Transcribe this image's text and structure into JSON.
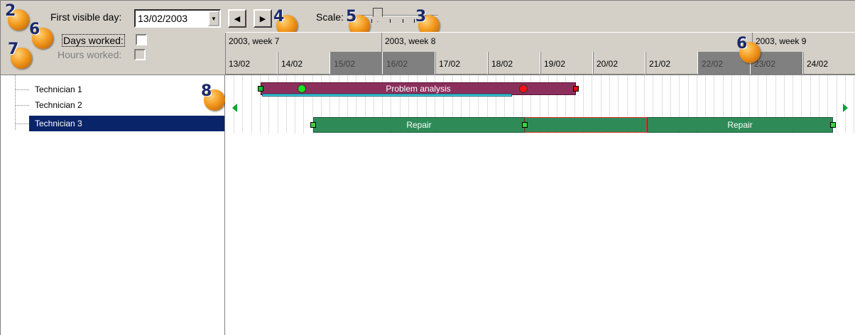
{
  "toolbar": {
    "first_visible_day_label": "First visible day:",
    "first_visible_day_value": "13/02/2003",
    "scale_label": "Scale:",
    "days_worked_label": "Days worked:",
    "hours_worked_label": "Hours worked:"
  },
  "weeks": [
    "2003, week 7",
    "2003, week 8",
    "2003, week 9"
  ],
  "days": [
    "13/02",
    "14/02",
    "15/02",
    "16/02",
    "17/02",
    "18/02",
    "19/02",
    "20/02",
    "21/02",
    "22/02",
    "23/02",
    "24/02"
  ],
  "weekend_days": [
    false,
    false,
    true,
    true,
    false,
    false,
    false,
    false,
    false,
    true,
    true,
    false
  ],
  "resources": [
    "Technician 1",
    "Technician 2",
    "Technician 3"
  ],
  "selected_resource": "Technician 3",
  "tasks": {
    "problem_analysis": "Problem analysis",
    "repair_1": "Repair",
    "repair_2": "Repair"
  },
  "badges": [
    "2",
    "6",
    "7",
    "4",
    "5",
    "3",
    "6",
    "8"
  ],
  "colors": {
    "window_bg": "#d4d0c8",
    "selection": "#0a246a",
    "problem_analysis_bar": "#8b2f5c",
    "repair_bar": "#2e8b57",
    "progress_line": "#40d0e0",
    "weekend_cell": "#808080"
  }
}
